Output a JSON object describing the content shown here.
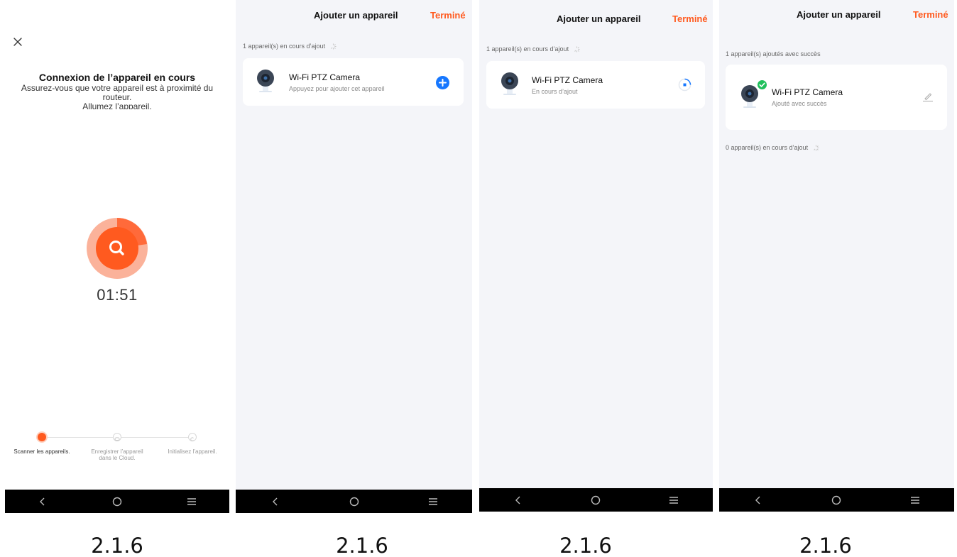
{
  "panel1": {
    "close_icon": "close-icon",
    "title": "Connexion de l’appareil en cours",
    "subtitle_lines": [
      "Assurez-vous que votre appareil est à proximité du",
      "routeur.",
      "Allumez l’appareil."
    ],
    "timer": "01:51",
    "steps": [
      {
        "label": "Scanner les appareils.",
        "state": "active"
      },
      {
        "label": "Enregistrer l’appareil dans le Cloud.",
        "state": "pending"
      },
      {
        "label": "Initialisez l’appareil.",
        "state": "pending"
      }
    ],
    "accent_color": "#ff5a1f"
  },
  "panel2": {
    "title": "Ajouter un appareil",
    "done_label": "Terminé",
    "section": "1 appareil(s) en cours d’ajout",
    "device": {
      "name": "Wi-Fi PTZ Camera",
      "status": "Appuyez pour ajouter cet appareil",
      "action_icon": "add-circle-icon"
    }
  },
  "panel3": {
    "title": "Ajouter un appareil",
    "done_label": "Terminé",
    "section": "1 appareil(s) en cours d’ajout",
    "device": {
      "name": "Wi-Fi PTZ Camera",
      "status": "En cours d’ajout",
      "action_icon": "loading-icon"
    }
  },
  "panel4": {
    "title": "Ajouter un appareil",
    "done_label": "Terminé",
    "section_success": "1 appareil(s) ajoutés avec succès",
    "device": {
      "name": "Wi-Fi PTZ Camera",
      "status": "Ajouté avec succès",
      "action_icon": "edit-icon",
      "badge_icon": "check-badge-icon"
    },
    "section_pending": "0 appareil(s) en cours d’ajout"
  },
  "captions": [
    "2.1.6",
    "2.1.6",
    "2.1.6",
    "2.1.6"
  ],
  "navbar_icons": [
    "back-icon",
    "home-icon",
    "menu-icon"
  ],
  "colors": {
    "accent": "#ff5a1f",
    "blue": "#1677ff",
    "success": "#20c05c",
    "bg": "#f4f5f9"
  }
}
